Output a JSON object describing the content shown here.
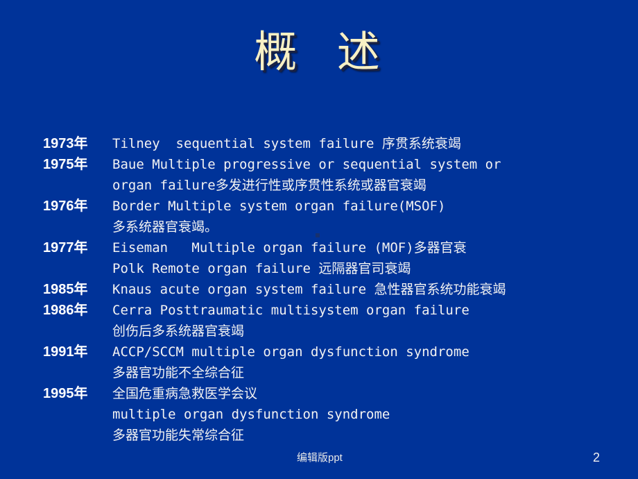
{
  "slide": {
    "background_color": "#003399",
    "title": "概  述",
    "title_color": "#F7F0C4",
    "body_text_color": "#F2F2F2",
    "year_label_color": "#FFFFFF"
  },
  "entries": [
    {
      "year": "1973年",
      "text": "Tilney  sequential system failure 序贯系统衰竭"
    },
    {
      "year": "1975年",
      "text": "Baue Multiple progressive or sequential system or"
    },
    {
      "year": "",
      "text": "organ failure多发进行性或序贯性系统或器官衰竭"
    },
    {
      "year": "1976年",
      "text": "Border Multiple system organ failure(MSOF)"
    },
    {
      "year": "",
      "text": "多系统器官衰竭。"
    },
    {
      "year": "1977年",
      "text": "Eiseman   Multiple organ failure (MOF)多器官衰"
    },
    {
      "year": "",
      "text": "Polk Remote organ failure 远隔器官司衰竭"
    },
    {
      "year": "1985年",
      "text": "Knaus acute organ system failure 急性器官系统功能衰竭"
    },
    {
      "year": "1986年",
      "text": "Cerra Posttraumatic multisystem organ failure"
    },
    {
      "year": "",
      "text": "创伤后多系统器官衰竭"
    },
    {
      "year": "1991年",
      "text": "ACCP/SCCM multiple organ dysfunction syndrome"
    },
    {
      "year": "",
      "text": "多器官功能不全综合征"
    },
    {
      "year": "1995年",
      "text": "全国危重病急救医学会议"
    },
    {
      "year": "",
      "text": "multiple organ dysfunction syndrome"
    },
    {
      "year": "",
      "text": "多器官功能失常综合征"
    }
  ],
  "footer": {
    "label": "编辑版ppt",
    "page_number": "2"
  }
}
